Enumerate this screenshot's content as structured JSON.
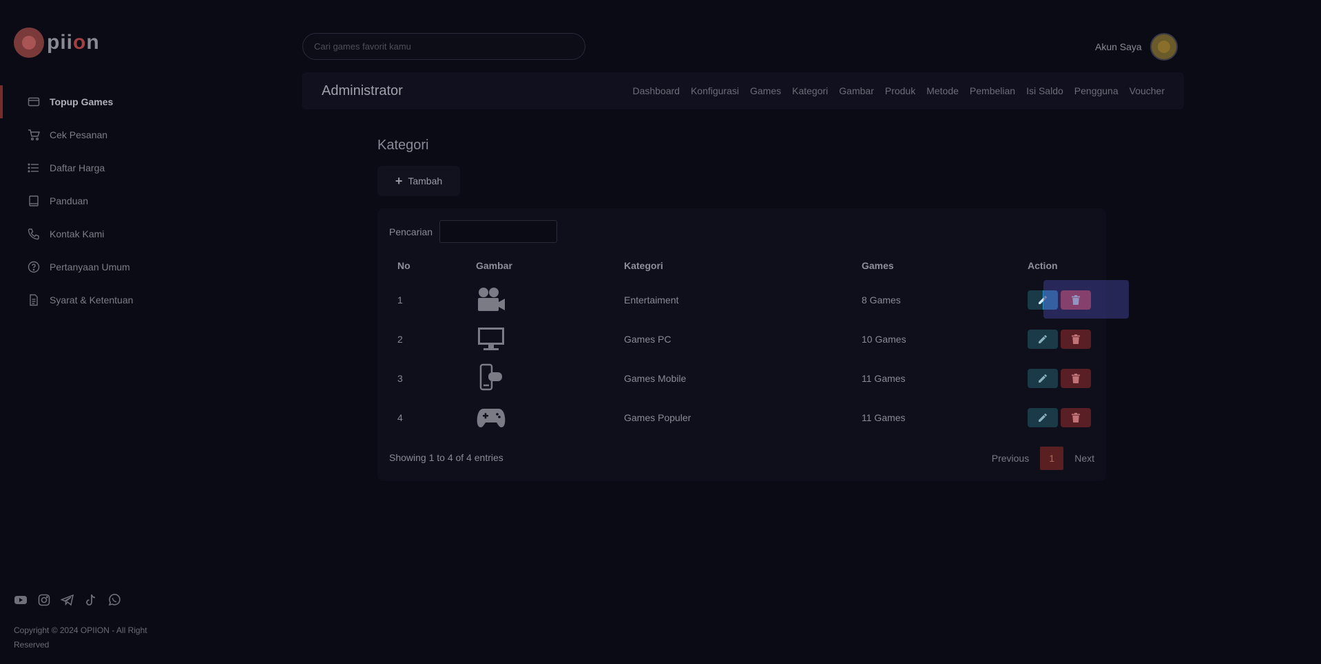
{
  "logo": {
    "text_prefix": "pii",
    "text_o": "o",
    "text_suffix": "n"
  },
  "sidebar": {
    "items": [
      {
        "label": "Topup Games",
        "icon": "card-icon",
        "active": true
      },
      {
        "label": "Cek Pesanan",
        "icon": "cart-icon"
      },
      {
        "label": "Daftar Harga",
        "icon": "list-icon"
      },
      {
        "label": "Panduan",
        "icon": "book-icon"
      },
      {
        "label": "Kontak Kami",
        "icon": "phone-icon"
      },
      {
        "label": "Pertanyaan Umum",
        "icon": "question-icon"
      },
      {
        "label": "Syarat & Ketentuan",
        "icon": "document-icon"
      }
    ],
    "social": [
      "youtube-icon",
      "instagram-icon",
      "telegram-icon",
      "tiktok-icon",
      "whatsapp-icon"
    ],
    "copyright": "Copyright © 2024 OPIION - All Right Reserved"
  },
  "header": {
    "search_placeholder": "Cari games favorit kamu",
    "account_label": "Akun Saya"
  },
  "admin_bar": {
    "title": "Administrator",
    "menu": [
      "Dashboard",
      "Konfigurasi",
      "Games",
      "Kategori",
      "Gambar",
      "Produk",
      "Metode",
      "Pembelian",
      "Isi Saldo",
      "Pengguna",
      "Voucher"
    ]
  },
  "main": {
    "title": "Kategori",
    "add_label": "Tambah",
    "search_label": "Pencarian",
    "table": {
      "headers": [
        "No",
        "Gambar",
        "Kategori",
        "Games",
        "Action"
      ],
      "rows": [
        {
          "no": "1",
          "icon": "video-camera-icon",
          "kategori": "Entertaiment",
          "games": "8 Games"
        },
        {
          "no": "2",
          "icon": "monitor-icon",
          "kategori": "Games PC",
          "games": "10 Games"
        },
        {
          "no": "3",
          "icon": "mobile-gamepad-icon",
          "kategori": "Games Mobile",
          "games": "11 Games"
        },
        {
          "no": "4",
          "icon": "gamepad-icon",
          "kategori": "Games Populer",
          "games": "11 Games"
        }
      ]
    },
    "info": "Showing 1 to 4 of 4 entries",
    "pager": {
      "previous": "Previous",
      "current": "1",
      "next": "Next"
    }
  },
  "colors": {
    "background": "#0b0b16",
    "accent": "#7a2b2b",
    "edit_button": "#2a8cbd",
    "delete_button": "#e04646"
  }
}
